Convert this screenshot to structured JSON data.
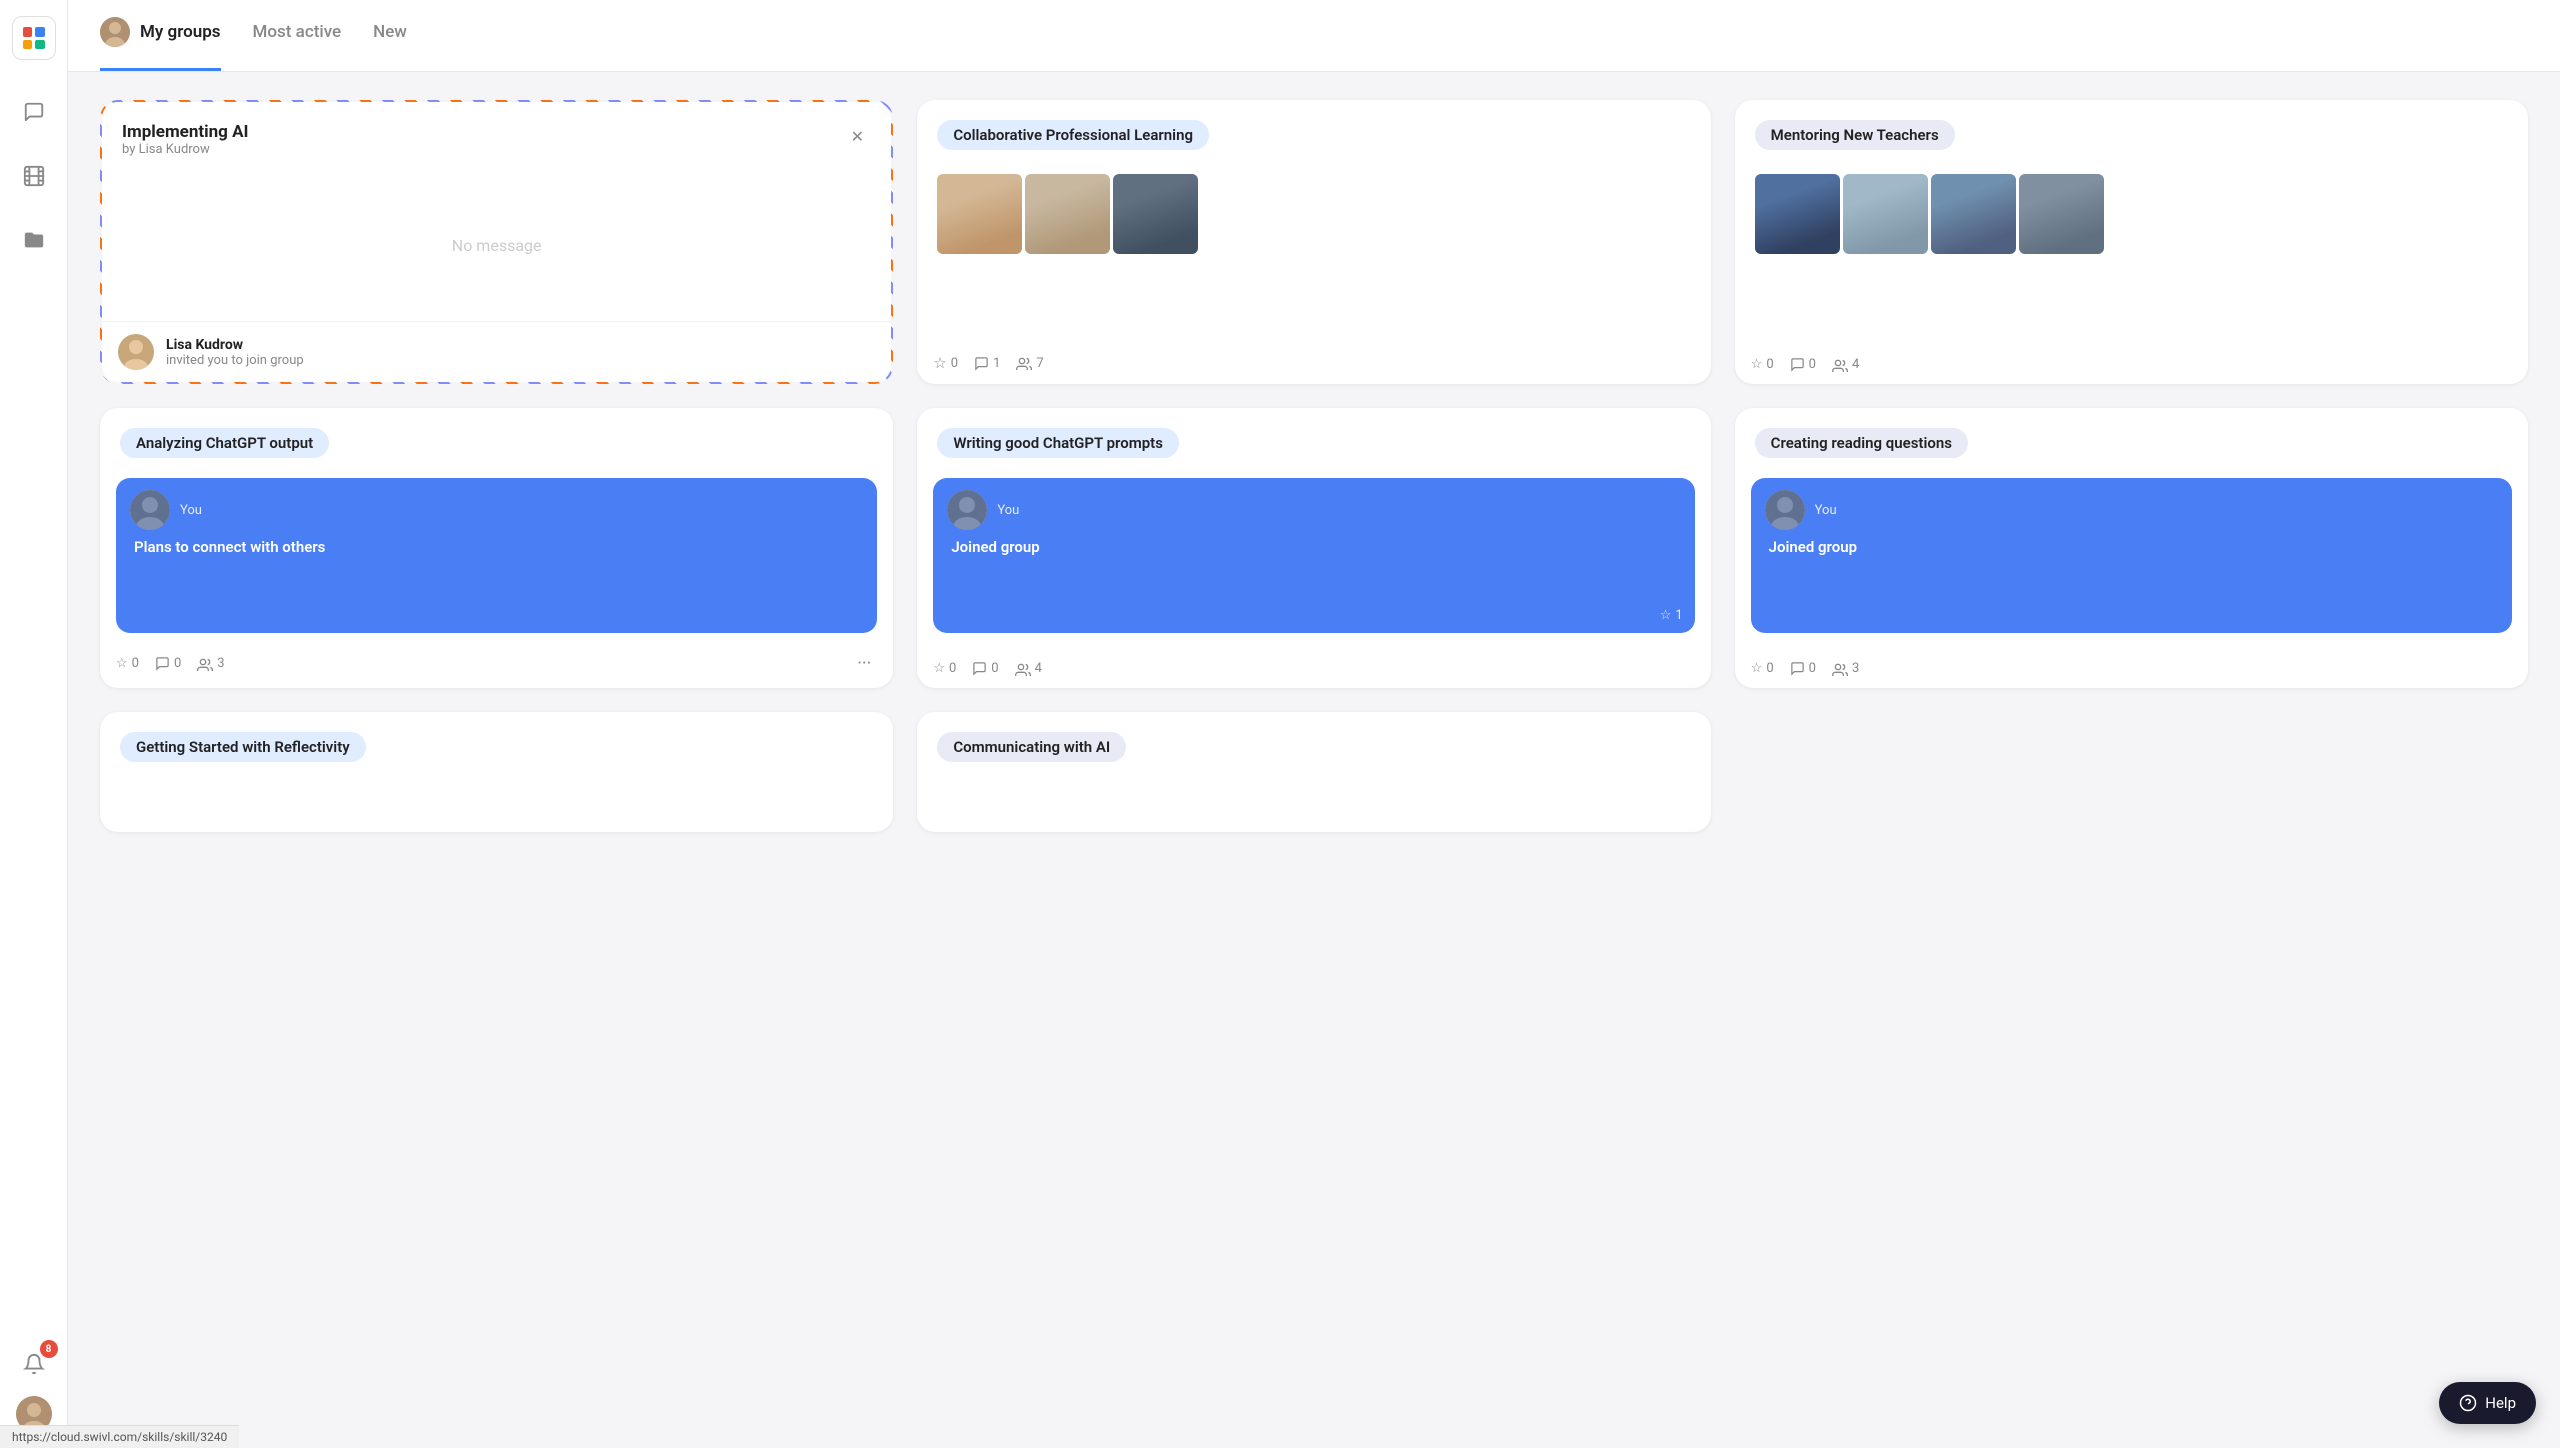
{
  "sidebar": {
    "logo_alt": "App Logo",
    "icons": [
      {
        "name": "chat-icon",
        "symbol": "💬",
        "interactable": true
      },
      {
        "name": "film-icon",
        "symbol": "🎞",
        "interactable": true
      },
      {
        "name": "folder-icon",
        "symbol": "📁",
        "interactable": true
      }
    ],
    "notification_count": "8",
    "user_alt": "User Avatar"
  },
  "tabs": {
    "items": [
      {
        "id": "my-groups",
        "label": "My groups",
        "active": true
      },
      {
        "id": "most-active",
        "label": "Most active",
        "active": false
      },
      {
        "id": "new",
        "label": "New",
        "active": false
      }
    ]
  },
  "cards": [
    {
      "id": "implementing-ai",
      "title": "Implementing AI",
      "subtitle": "by Lisa Kudrow",
      "type": "invite",
      "no_message": "No message",
      "inviter_name": "Lisa Kudrow",
      "inviter_action": "invited you to join group",
      "has_close": true,
      "stats": null
    },
    {
      "id": "collaborative-professional-learning",
      "title": "Collaborative Professional Learning",
      "type": "members",
      "member_count": "7",
      "comment_count": "1",
      "star_count": "0",
      "has_close": false,
      "stats": {
        "stars": "0",
        "comments": "1",
        "members": "7"
      }
    },
    {
      "id": "mentoring-new-teachers",
      "title": "Mentoring New Teachers",
      "type": "members",
      "has_close": false,
      "stats": {
        "stars": "0",
        "comments": "0",
        "members": "4"
      }
    },
    {
      "id": "analyzing-chatgpt-output",
      "title": "Analyzing ChatGPT output",
      "type": "message",
      "you_label": "You",
      "message": "Plans to connect with others",
      "has_close": false,
      "stats": {
        "stars": "0",
        "comments": "0",
        "members": "3"
      },
      "has_more": true
    },
    {
      "id": "writing-good-chatgpt-prompts",
      "title": "Writing good ChatGPT prompts",
      "type": "message",
      "you_label": "You",
      "message": "Joined group",
      "has_close": false,
      "stats": {
        "stars": "0",
        "comments": "0",
        "members": "4"
      },
      "star_on_card": "1"
    },
    {
      "id": "creating-reading-questions",
      "title": "Creating reading questions",
      "type": "message",
      "you_label": "You",
      "message": "Joined group",
      "has_close": false,
      "stats": {
        "stars": "0",
        "comments": "0",
        "members": "3"
      }
    },
    {
      "id": "getting-started-with-reflectivity",
      "title": "Getting Started with Reflectivity",
      "type": "partial",
      "has_close": false,
      "stats": null
    },
    {
      "id": "communicating-ai",
      "title": "Communicating with AI",
      "type": "partial",
      "has_close": false,
      "stats": null
    }
  ],
  "help_label": "Help",
  "url_bar": "https://cloud.swivl.com/skills/skill/3240",
  "stat_labels": {
    "star": "☆",
    "comment": "💬",
    "members": "👥"
  }
}
